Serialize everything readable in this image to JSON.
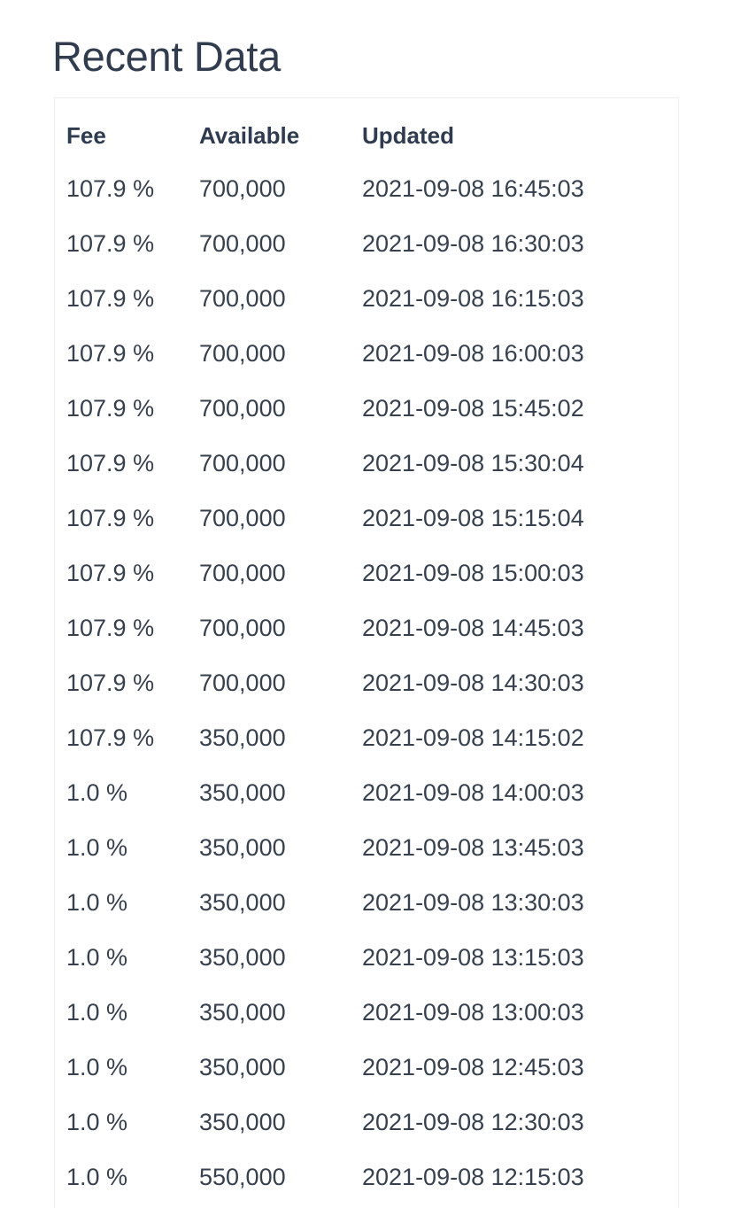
{
  "page": {
    "title": "Recent Data",
    "background_color": "#ffffff",
    "text_color": "#2f3c4f",
    "border_color": "#eceef0"
  },
  "table": {
    "name": "recent-data-table",
    "columns": [
      {
        "key": "fee",
        "label": "Fee"
      },
      {
        "key": "available",
        "label": "Available"
      },
      {
        "key": "updated",
        "label": "Updated"
      }
    ],
    "rows": [
      {
        "fee": "107.9 %",
        "available": "700,000",
        "updated": "2021-09-08 16:45:03"
      },
      {
        "fee": "107.9 %",
        "available": "700,000",
        "updated": "2021-09-08 16:30:03"
      },
      {
        "fee": "107.9 %",
        "available": "700,000",
        "updated": "2021-09-08 16:15:03"
      },
      {
        "fee": "107.9 %",
        "available": "700,000",
        "updated": "2021-09-08 16:00:03"
      },
      {
        "fee": "107.9 %",
        "available": "700,000",
        "updated": "2021-09-08 15:45:02"
      },
      {
        "fee": "107.9 %",
        "available": "700,000",
        "updated": "2021-09-08 15:30:04"
      },
      {
        "fee": "107.9 %",
        "available": "700,000",
        "updated": "2021-09-08 15:15:04"
      },
      {
        "fee": "107.9 %",
        "available": "700,000",
        "updated": "2021-09-08 15:00:03"
      },
      {
        "fee": "107.9 %",
        "available": "700,000",
        "updated": "2021-09-08 14:45:03"
      },
      {
        "fee": "107.9 %",
        "available": "700,000",
        "updated": "2021-09-08 14:30:03"
      },
      {
        "fee": "107.9 %",
        "available": "350,000",
        "updated": "2021-09-08 14:15:02"
      },
      {
        "fee": "1.0 %",
        "available": "350,000",
        "updated": "2021-09-08 14:00:03"
      },
      {
        "fee": "1.0 %",
        "available": "350,000",
        "updated": "2021-09-08 13:45:03"
      },
      {
        "fee": "1.0 %",
        "available": "350,000",
        "updated": "2021-09-08 13:30:03"
      },
      {
        "fee": "1.0 %",
        "available": "350,000",
        "updated": "2021-09-08 13:15:03"
      },
      {
        "fee": "1.0 %",
        "available": "350,000",
        "updated": "2021-09-08 13:00:03"
      },
      {
        "fee": "1.0 %",
        "available": "350,000",
        "updated": "2021-09-08 12:45:03"
      },
      {
        "fee": "1.0 %",
        "available": "350,000",
        "updated": "2021-09-08 12:30:03"
      },
      {
        "fee": "1.0 %",
        "available": "550,000",
        "updated": "2021-09-08 12:15:03"
      }
    ]
  }
}
